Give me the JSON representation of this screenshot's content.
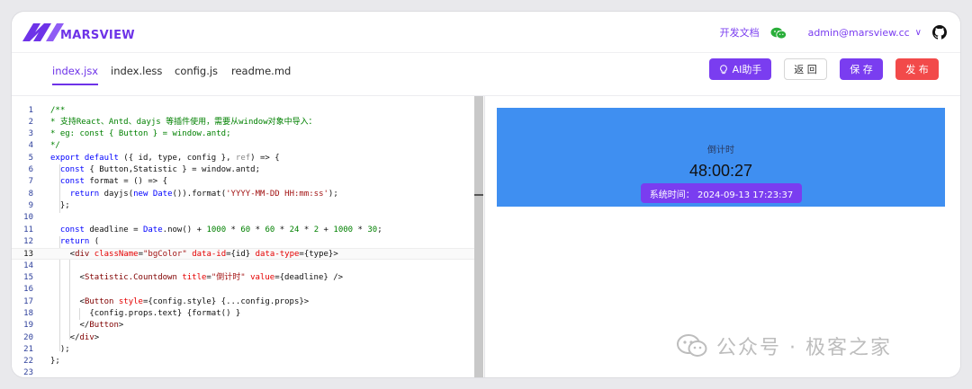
{
  "header": {
    "logo_text": "MARSVIEW",
    "docs_label": "开发文档",
    "user_email": "admin@marsview.cc",
    "chevron": "∨"
  },
  "tabs": [
    {
      "label": "index.jsx",
      "active": true
    },
    {
      "label": "index.less",
      "active": false
    },
    {
      "label": "config.js",
      "active": false
    },
    {
      "label": "readme.md",
      "active": false
    }
  ],
  "toolbar": {
    "ai_label": "AI助手",
    "back_label": "返 回",
    "save_label": "保 存",
    "publish_label": "发 布"
  },
  "editor": {
    "current_line": 13,
    "line_numbers": [
      "1",
      "2",
      "3",
      "4",
      "5",
      "6",
      "7",
      "8",
      "9",
      "10",
      "11",
      "12",
      "13",
      "14",
      "15",
      "16",
      "17",
      "18",
      "19",
      "20",
      "21",
      "22",
      "23"
    ]
  },
  "preview": {
    "countdown_title": "倒计时",
    "countdown_value": "48:00:27",
    "button_text": "系统时间： 2024-09-13 17:23:37"
  },
  "watermark": {
    "text": "公众号 · 极客之家"
  },
  "colors": {
    "brand": "#6e33e8",
    "publish": "#f24a4a",
    "preview_bg": "#3f8ff1"
  }
}
